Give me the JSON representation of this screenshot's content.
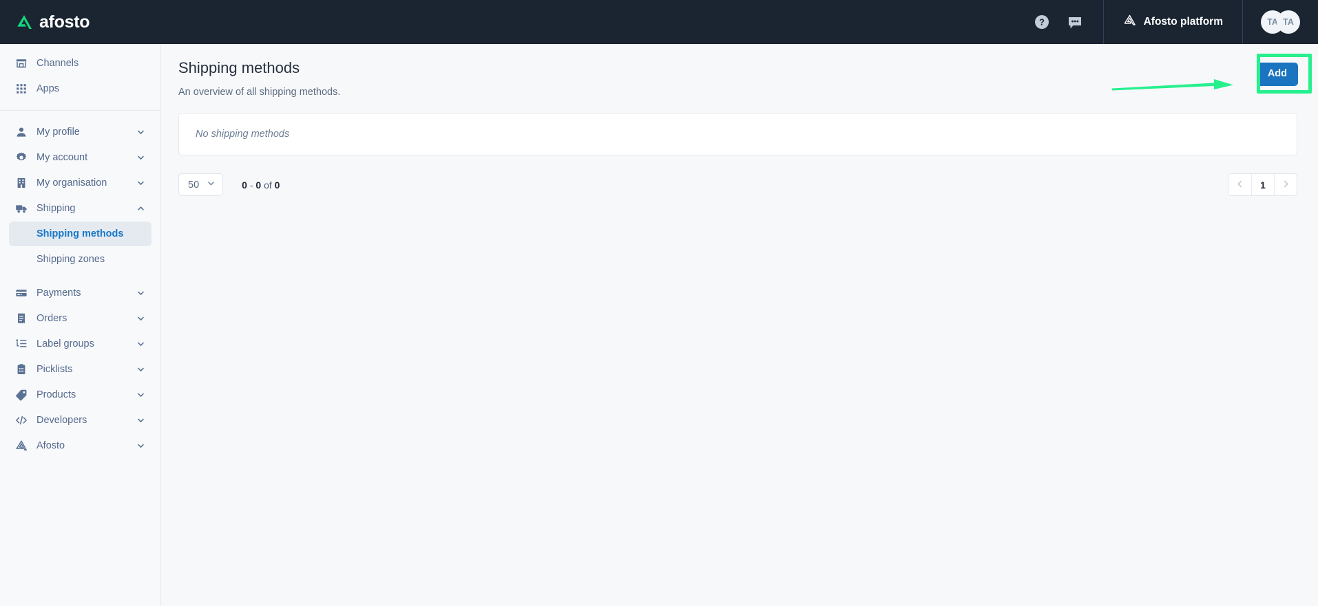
{
  "topbar": {
    "brand": "afosto",
    "brand_icon": "afosto-triangle-logo",
    "help_icon": "help-circle-icon",
    "chat_icon": "chat-bubble-icon",
    "platform_label": "Afosto platform",
    "platform_icon": "afosto-triangle-icon",
    "avatars": [
      {
        "initials": "TA"
      },
      {
        "initials": "TA"
      }
    ]
  },
  "sidebar": {
    "top_items": [
      {
        "label": "Channels",
        "icon": "store-icon",
        "expandable": false
      },
      {
        "label": "Apps",
        "icon": "grid-icon",
        "expandable": false
      }
    ],
    "groups": [
      {
        "label": "My profile",
        "icon": "user-icon",
        "state": "collapsed"
      },
      {
        "label": "My account",
        "icon": "gear-icon",
        "state": "collapsed"
      },
      {
        "label": "My organisation",
        "icon": "building-icon",
        "state": "collapsed"
      },
      {
        "label": "Shipping",
        "icon": "truck-icon",
        "state": "expanded"
      }
    ],
    "shipping_children": [
      {
        "label": "Shipping methods",
        "active": true
      },
      {
        "label": "Shipping zones",
        "active": false
      }
    ],
    "lower_groups": [
      {
        "label": "Payments",
        "icon": "credit-card-icon",
        "state": "collapsed"
      },
      {
        "label": "Orders",
        "icon": "receipt-icon",
        "state": "collapsed"
      },
      {
        "label": "Label groups",
        "icon": "label-list-icon",
        "state": "collapsed"
      },
      {
        "label": "Picklists",
        "icon": "clipboard-icon",
        "state": "collapsed"
      },
      {
        "label": "Products",
        "icon": "tag-icon",
        "state": "collapsed"
      },
      {
        "label": "Developers",
        "icon": "code-icon",
        "state": "collapsed"
      },
      {
        "label": "Afosto",
        "icon": "afosto-triangle-icon",
        "state": "collapsed"
      }
    ]
  },
  "page": {
    "title": "Shipping methods",
    "subtitle": "An overview of all shipping methods.",
    "add_label": "Add",
    "empty_message": "No shipping methods"
  },
  "pagination": {
    "per_page": "50",
    "range_from": "0",
    "range_to": "0",
    "separator": "-",
    "of_label": "of",
    "total": "0",
    "current_page": "1",
    "prev_icon": "chevron-left-icon",
    "next_icon": "chevron-right-icon"
  },
  "annotations": {
    "highlight_color": "#26f08e",
    "highlight_target": "Add",
    "arrow_icon": "pointer-arrow-right"
  },
  "colors": {
    "topbar_bg": "#1b2431",
    "brand_green": "#14d67f",
    "accent_blue": "#1a74c0",
    "active_nav_blue": "#1878c8",
    "page_bg": "#f7f8fa",
    "sidebar_bg": "#f8f9fb",
    "annotation_green": "#26f08e"
  }
}
